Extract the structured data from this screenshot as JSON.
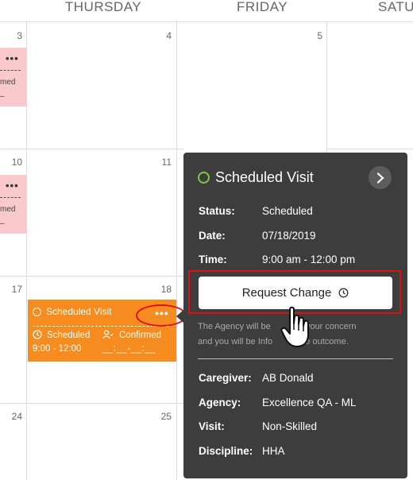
{
  "calendar": {
    "days": [
      "THURSDAY",
      "FRIDAY",
      "SATU"
    ],
    "dates": [
      "3",
      "4",
      "5",
      "10",
      "11",
      "17",
      "18",
      "24",
      "25"
    ],
    "pink_card_lines": [
      "med",
      "–"
    ],
    "pink_dots": "•••"
  },
  "visit_card": {
    "title": "Scheduled Visit",
    "status": "Scheduled",
    "confirm": "Confirmed",
    "time": "9:00 - 12:00",
    "blank": "__:__-__:__",
    "dots": "•••",
    "color": "#f68b1f"
  },
  "popover": {
    "title": "Scheduled Visit",
    "fields": [
      {
        "label": "Status:",
        "value": "Scheduled"
      },
      {
        "label": "Date:",
        "value": "07/18/2019"
      },
      {
        "label": "Time:",
        "value": "9:00 am - 12:00 pm"
      }
    ],
    "request_button": "Request Change",
    "note_line1": "The Agency will be",
    "note_line1b": "of your concern",
    "note_line2": "and you will be Info",
    "note_line2b": "the outcome.",
    "details": [
      {
        "label": "Caregiver:",
        "value": "AB Donald"
      },
      {
        "label": "Agency:",
        "value": "Excellence QA - ML"
      },
      {
        "label": "Visit:",
        "value": "Non-Skilled"
      },
      {
        "label": "Discipline:",
        "value": "HHA"
      }
    ],
    "background": "#3d3d3d",
    "status_color": "#7ac943"
  },
  "icons": [
    "chevron-right-icon",
    "clock-icon",
    "person-icon",
    "hand-cursor-icon"
  ]
}
